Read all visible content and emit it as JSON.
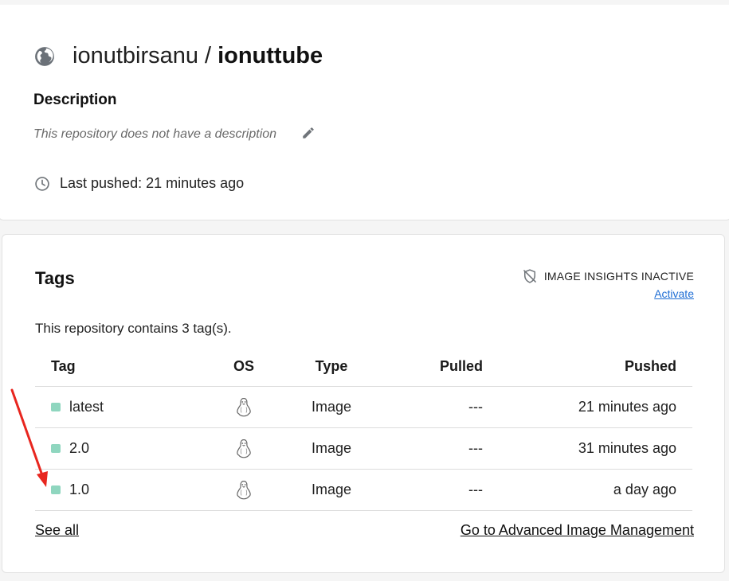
{
  "repo": {
    "namespace": "ionutbirsanu",
    "separator": "/",
    "name": "ionuttube",
    "description_label": "Description",
    "description_text": "This repository does not have a description",
    "last_pushed": "Last pushed: 21 minutes ago"
  },
  "tags_panel": {
    "title": "Tags",
    "insights_label": "IMAGE INSIGHTS INACTIVE",
    "activate_label": "Activate",
    "contains_text": "This repository contains 3 tag(s).",
    "columns": [
      "Tag",
      "OS",
      "Type",
      "Pulled",
      "Pushed"
    ],
    "rows": [
      {
        "tag": "latest",
        "os": "linux-icon",
        "type": "Image",
        "pulled": "---",
        "pushed": "21 minutes ago"
      },
      {
        "tag": "2.0",
        "os": "linux-icon",
        "type": "Image",
        "pulled": "---",
        "pushed": "31 minutes ago"
      },
      {
        "tag": "1.0",
        "os": "linux-icon",
        "type": "Image",
        "pulled": "---",
        "pushed": "a day ago"
      }
    ],
    "see_all_label": "See all",
    "advanced_label": "Go to Advanced Image Management"
  },
  "colors": {
    "tag_dot": "#8fd6bf",
    "link": "#1f6ed4",
    "annotation_arrow": "#e8261f"
  }
}
